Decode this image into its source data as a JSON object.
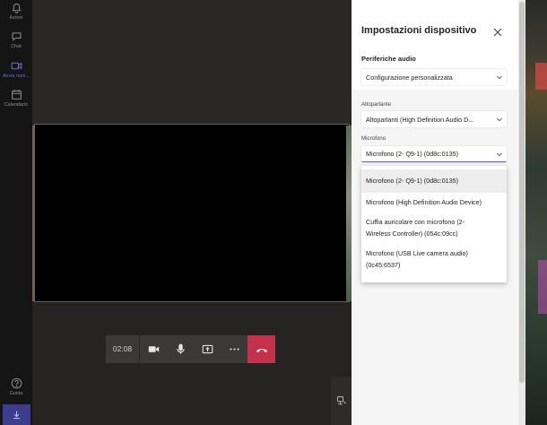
{
  "rail": {
    "items": [
      {
        "label": "Azioni",
        "icon": "bell-icon"
      },
      {
        "label": "Chat",
        "icon": "chat-icon"
      },
      {
        "label": "Avvia riuni...",
        "icon": "video-icon"
      },
      {
        "label": "Calendario",
        "icon": "calendar-icon"
      }
    ],
    "help_label": "Guida"
  },
  "call": {
    "timer": "02:08"
  },
  "panel": {
    "title": "Impostazioni dispositivo",
    "audio_label": "Periferiche audio",
    "audio_value": "Configurazione personalizzata",
    "speaker_label": "Altoparlante",
    "speaker_value": "Altoparlanti (High Definition Audio D...",
    "mic_label": "Microfono",
    "mic_value": "Microfono (2- Q9-1) (0d8c:0135)",
    "mic_options": [
      "Microfono (2- Q9-1) (0d8c:0135)",
      "Microfono (High Definition Audio Device)",
      "Cuffia auricolare con microfono (2-",
      "Wireless Controller) (054c:09cc)",
      "Microfono (USB Live camera audio)",
      "(0c45:6537)"
    ]
  },
  "colors": {
    "accent": "#5b5fc7",
    "hangup": "#c4314b"
  }
}
